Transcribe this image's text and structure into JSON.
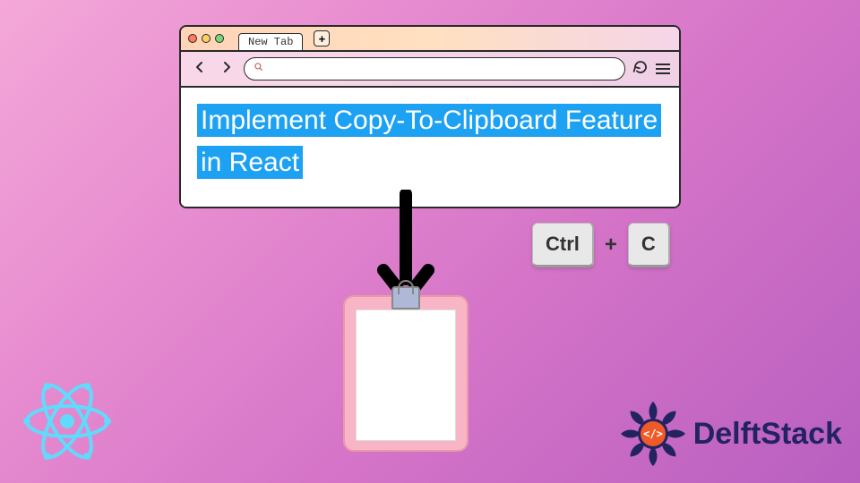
{
  "browser": {
    "tab_label": "New Tab",
    "new_tab_plus": "+",
    "content_text": "Implement Copy-To-Clipboard Feature in React"
  },
  "shortcut": {
    "key1": "Ctrl",
    "plus": "+",
    "key2": "C"
  },
  "brand": {
    "name": "DelftStack",
    "code_symbol": "</>"
  },
  "colors": {
    "highlight_bg": "#1da1f2",
    "highlight_fg": "#ffffff",
    "react": "#61dafb",
    "delft_primary": "#232362",
    "delft_accent": "#f05a28"
  }
}
